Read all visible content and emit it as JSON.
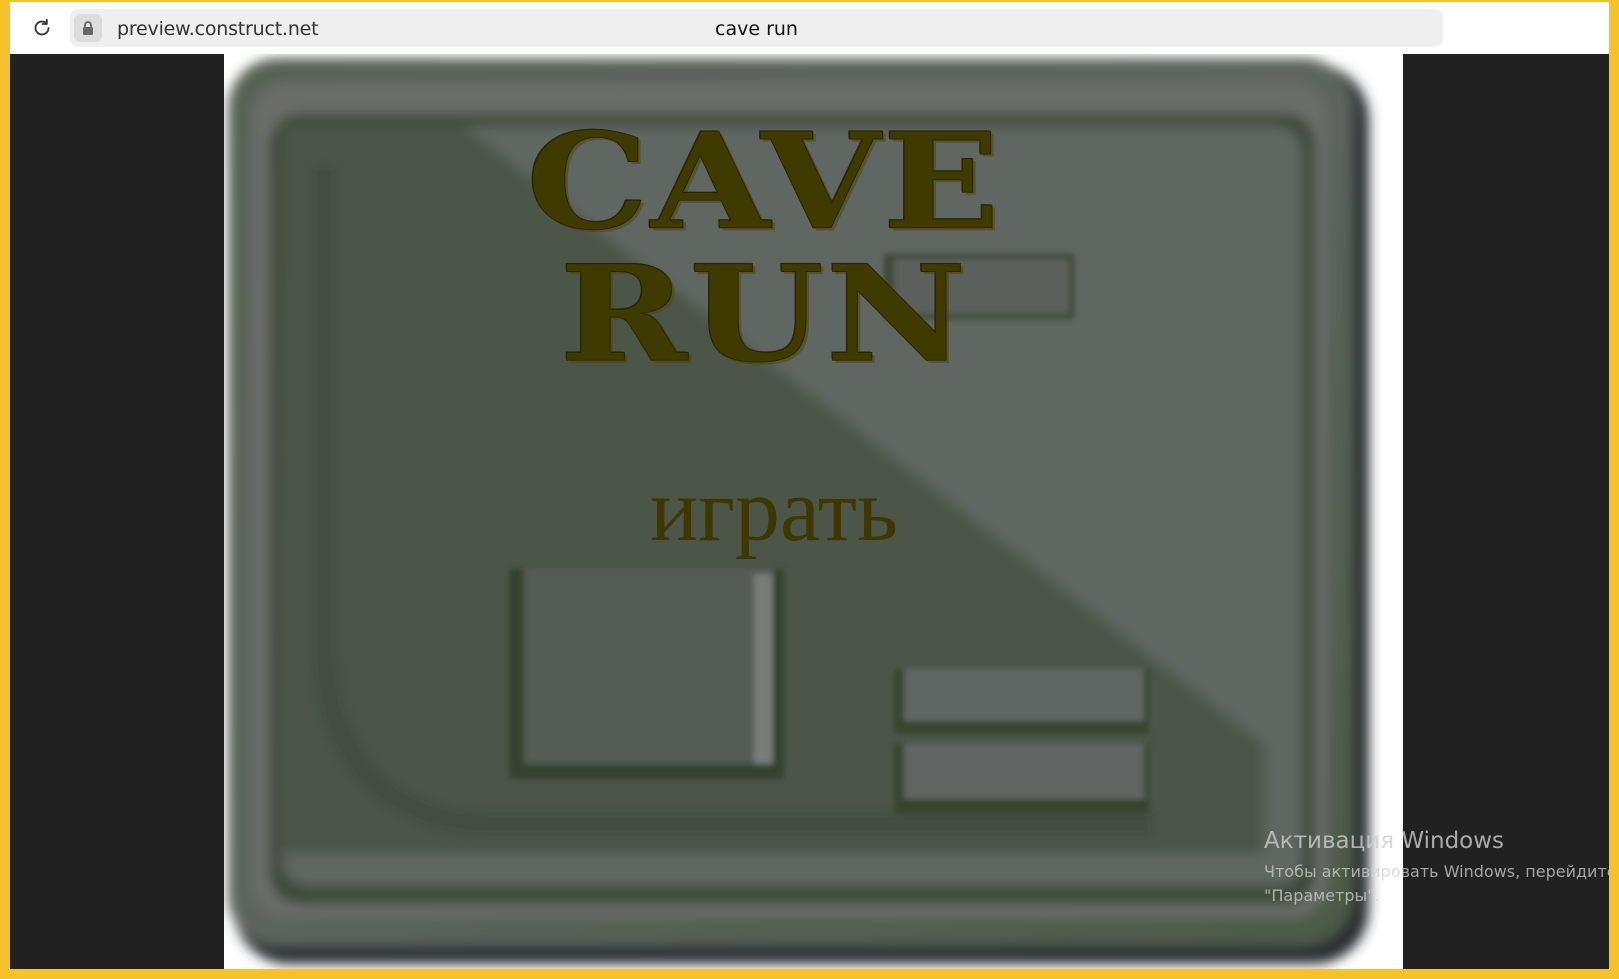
{
  "browser": {
    "url": "preview.construct.net",
    "title": "cave run"
  },
  "game": {
    "logo_text": "CAVE RUN",
    "play_label": "играть"
  },
  "watermark": {
    "heading": "Активация Windows",
    "line1": "Чтобы активировать Windows, перейдите в",
    "line2": "\"Параметры\"."
  },
  "colors": {
    "frame": "#f5c22b",
    "letterbox": "#212121",
    "text": "#3e3700",
    "panel": "#5b615b",
    "panel_dark": "#3e4b38"
  }
}
